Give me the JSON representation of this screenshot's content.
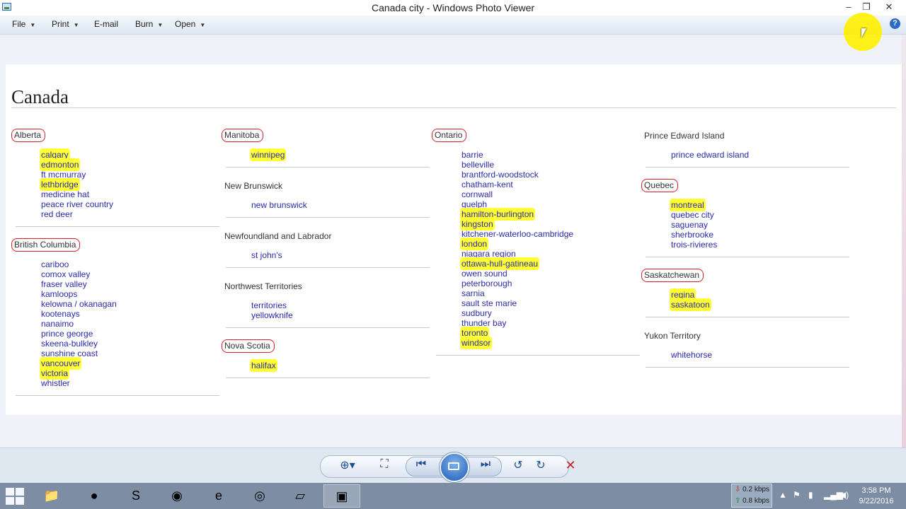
{
  "window": {
    "title": "Canada city - Windows Photo Viewer"
  },
  "window_controls": {
    "minimize": "–",
    "maximize": "❐",
    "close": "✕"
  },
  "menu": [
    {
      "label": "File",
      "dropdown": true
    },
    {
      "label": "Print",
      "dropdown": true
    },
    {
      "label": "E-mail",
      "dropdown": false
    },
    {
      "label": "Burn",
      "dropdown": true
    },
    {
      "label": "Open",
      "dropdown": true
    }
  ],
  "help_label": "?",
  "page": {
    "title": "Canada"
  },
  "columns": [
    [
      {
        "name": "Alberta",
        "circled": true,
        "cities": [
          {
            "name": "calgary",
            "hl": true
          },
          {
            "name": "edmonton",
            "hl": true
          },
          {
            "name": "ft mcmurray",
            "hl": false
          },
          {
            "name": "lethbridge",
            "hl": true
          },
          {
            "name": "medicine hat",
            "hl": false
          },
          {
            "name": "peace river country",
            "hl": false
          },
          {
            "name": "red deer",
            "hl": false
          }
        ]
      },
      {
        "name": "British Columbia",
        "circled": true,
        "cities": [
          {
            "name": "cariboo",
            "hl": false
          },
          {
            "name": "comox valley",
            "hl": false
          },
          {
            "name": "fraser valley",
            "hl": false
          },
          {
            "name": "kamloops",
            "hl": false
          },
          {
            "name": "kelowna / okanagan",
            "hl": false
          },
          {
            "name": "kootenays",
            "hl": false
          },
          {
            "name": "nanaimo",
            "hl": false
          },
          {
            "name": "prince george",
            "hl": false
          },
          {
            "name": "skeena-bulkley",
            "hl": false
          },
          {
            "name": "sunshine coast",
            "hl": false
          },
          {
            "name": "vancouver",
            "hl": true
          },
          {
            "name": "victoria",
            "hl": true
          },
          {
            "name": "whistler",
            "hl": false
          }
        ]
      }
    ],
    [
      {
        "name": "Manitoba",
        "circled": true,
        "cities": [
          {
            "name": "winnipeg",
            "hl": true
          }
        ]
      },
      {
        "name": "New Brunswick",
        "circled": false,
        "cities": [
          {
            "name": "new brunswick",
            "hl": false
          }
        ]
      },
      {
        "name": "Newfoundland and Labrador",
        "circled": false,
        "cities": [
          {
            "name": "st john's",
            "hl": false
          }
        ]
      },
      {
        "name": "Northwest Territories",
        "circled": false,
        "cities": [
          {
            "name": "territories",
            "hl": false
          },
          {
            "name": "yellowknife",
            "hl": false
          }
        ]
      },
      {
        "name": "Nova Scotia",
        "circled": true,
        "cities": [
          {
            "name": "halifax",
            "hl": true
          }
        ]
      }
    ],
    [
      {
        "name": "Ontario",
        "circled": true,
        "cities": [
          {
            "name": "barrie",
            "hl": false
          },
          {
            "name": "belleville",
            "hl": false
          },
          {
            "name": "brantford-woodstock",
            "hl": false
          },
          {
            "name": "chatham-kent",
            "hl": false
          },
          {
            "name": "cornwall",
            "hl": false
          },
          {
            "name": "guelph",
            "hl": false
          },
          {
            "name": "hamilton-burlington",
            "hl": true
          },
          {
            "name": "kingston",
            "hl": true
          },
          {
            "name": "kitchener-waterloo-cambridge",
            "hl": false
          },
          {
            "name": "london",
            "hl": true
          },
          {
            "name": "niagara region",
            "hl": false
          },
          {
            "name": "ottawa-hull-gatineau",
            "hl": true
          },
          {
            "name": "owen sound",
            "hl": false
          },
          {
            "name": "peterborough",
            "hl": false
          },
          {
            "name": "sarnia",
            "hl": false
          },
          {
            "name": "sault ste marie",
            "hl": false
          },
          {
            "name": "sudbury",
            "hl": false
          },
          {
            "name": "thunder bay",
            "hl": false
          },
          {
            "name": "toronto",
            "hl": true
          },
          {
            "name": "windsor",
            "hl": true
          }
        ]
      }
    ],
    [
      {
        "name": "Prince Edward Island",
        "circled": false,
        "cities": [
          {
            "name": "prince edward island",
            "hl": false
          }
        ]
      },
      {
        "name": "Quebec",
        "circled": true,
        "cities": [
          {
            "name": "montreal",
            "hl": true
          },
          {
            "name": "quebec city",
            "hl": false
          },
          {
            "name": "saguenay",
            "hl": false
          },
          {
            "name": "sherbrooke",
            "hl": false
          },
          {
            "name": "trois-rivieres",
            "hl": false
          }
        ]
      },
      {
        "name": "Saskatchewan",
        "circled": true,
        "cities": [
          {
            "name": "regina",
            "hl": true
          },
          {
            "name": "saskatoon",
            "hl": true
          }
        ]
      },
      {
        "name": "Yukon Territory",
        "circled": false,
        "cities": [
          {
            "name": "whitehorse",
            "hl": false
          }
        ]
      }
    ]
  ],
  "controls": [
    {
      "name": "zoom-icon",
      "glyph": "⊕▾"
    },
    {
      "name": "actual-size-icon",
      "glyph": "⛶"
    },
    {
      "name": "previous-icon",
      "glyph": "⏮"
    },
    {
      "name": "slideshow-icon",
      "glyph": ""
    },
    {
      "name": "next-icon",
      "glyph": "⏭"
    },
    {
      "name": "rotate-counterclockwise-icon",
      "glyph": "↺"
    },
    {
      "name": "rotate-clockwise-icon",
      "glyph": "↻"
    },
    {
      "name": "delete-icon",
      "glyph": "✕"
    }
  ],
  "taskbar": {
    "apps": [
      {
        "name": "file-explorer-icon",
        "glyph": "📁"
      },
      {
        "name": "steam-icon",
        "glyph": "●"
      },
      {
        "name": "skype-icon",
        "glyph": "S"
      },
      {
        "name": "firefox-icon",
        "glyph": "◉"
      },
      {
        "name": "internet-explorer-icon",
        "glyph": "e"
      },
      {
        "name": "chrome-icon",
        "glyph": "◎"
      },
      {
        "name": "notepad-icon",
        "glyph": "▱"
      },
      {
        "name": "photo-viewer-icon",
        "glyph": "▣"
      }
    ],
    "net_down": "0.2 kbps",
    "net_up": "0.8 kbps",
    "time": "3:58 PM",
    "date": "9/22/2016"
  }
}
